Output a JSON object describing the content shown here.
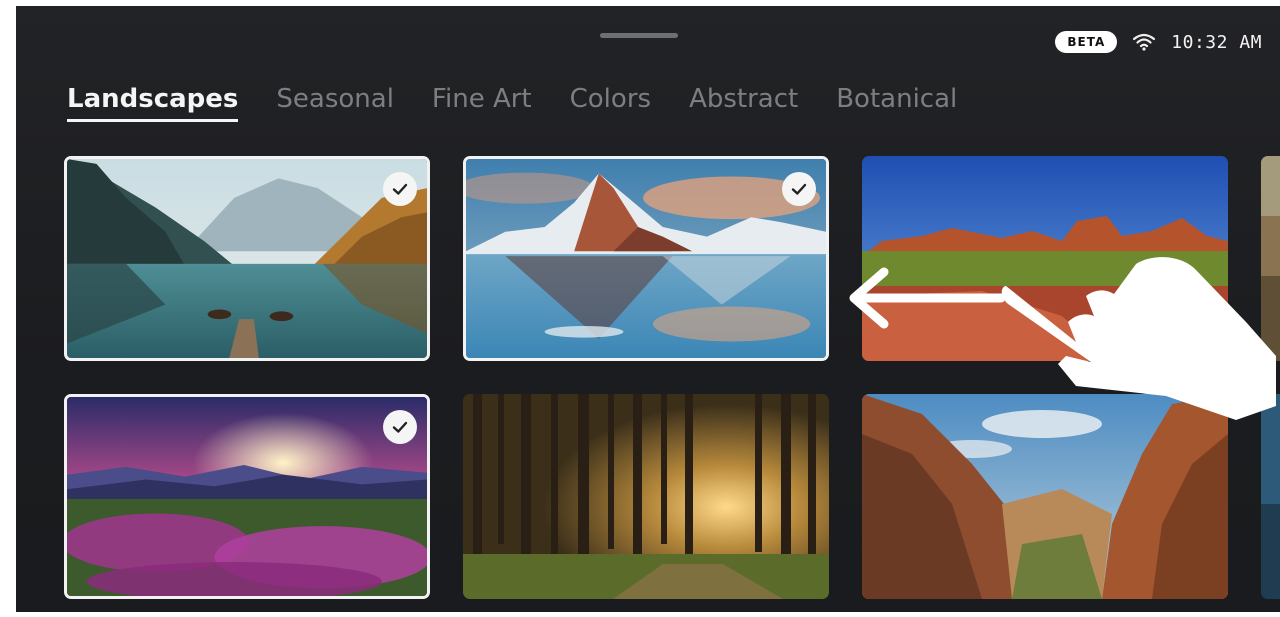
{
  "status": {
    "badge": "BETA",
    "time": "10:32 AM"
  },
  "tabs": [
    {
      "label": "Landscapes",
      "active": true
    },
    {
      "label": "Seasonal",
      "active": false
    },
    {
      "label": "Fine Art",
      "active": false
    },
    {
      "label": "Colors",
      "active": false
    },
    {
      "label": "Abstract",
      "active": false
    },
    {
      "label": "Botanical",
      "active": false
    }
  ],
  "tiles": [
    {
      "name": "mountain-lake-boats-image",
      "selected": true
    },
    {
      "name": "snowy-mountain-reflection-image",
      "selected": true
    },
    {
      "name": "red-rock-desert-image",
      "selected": false
    },
    {
      "name": "mountain-sunset-flowers-image",
      "selected": true
    },
    {
      "name": "sunlit-forest-image",
      "selected": false
    },
    {
      "name": "canyon-valley-image",
      "selected": false
    }
  ],
  "colors": {
    "background": "#1c1d20",
    "active_tab": "#f5f5f5",
    "inactive_tab": "#7d7e82"
  }
}
